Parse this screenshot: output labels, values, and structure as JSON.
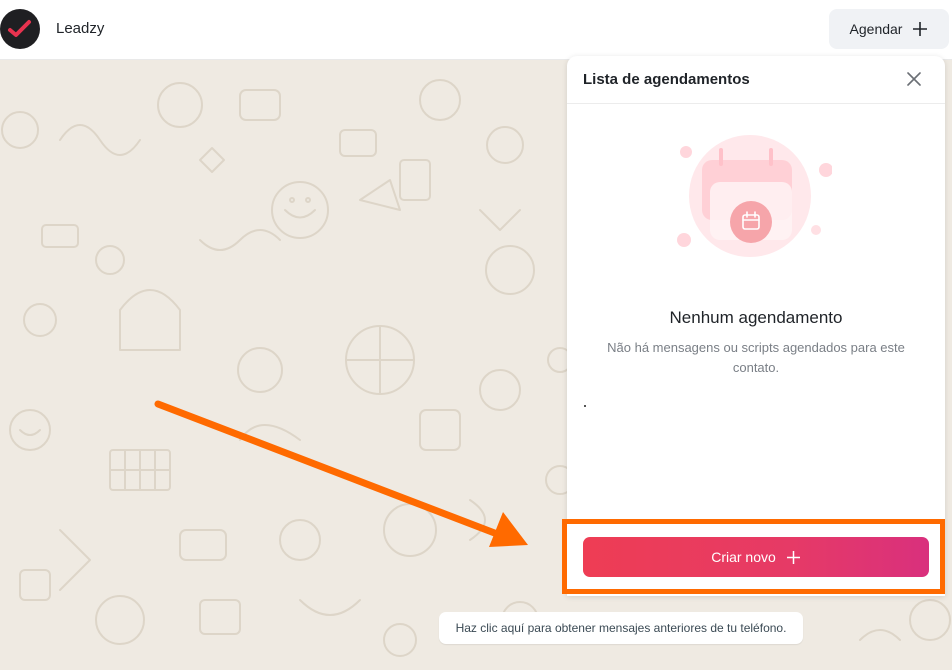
{
  "header": {
    "brand": "Leadzy",
    "agendar_label": "Agendar"
  },
  "panel": {
    "title": "Lista de agendamentos",
    "empty_title": "Nenhum agendamento",
    "empty_desc": "Não há mensagens ou scripts agendados para este contato.",
    "create_label": "Criar novo"
  },
  "chat": {
    "load_older": "Haz clic aquí para obtener mensajes anteriores de tu teléfono."
  },
  "icons": {
    "logo": "check-icon",
    "agendar": "plus-icon",
    "close": "close-icon",
    "calendar": "calendar-icon",
    "create": "plus-icon"
  },
  "colors": {
    "brand_accent": "#e8334f",
    "button_gradient_start": "#ee3d54",
    "button_gradient_end": "#d9307d",
    "annotation": "#ff6a00"
  }
}
